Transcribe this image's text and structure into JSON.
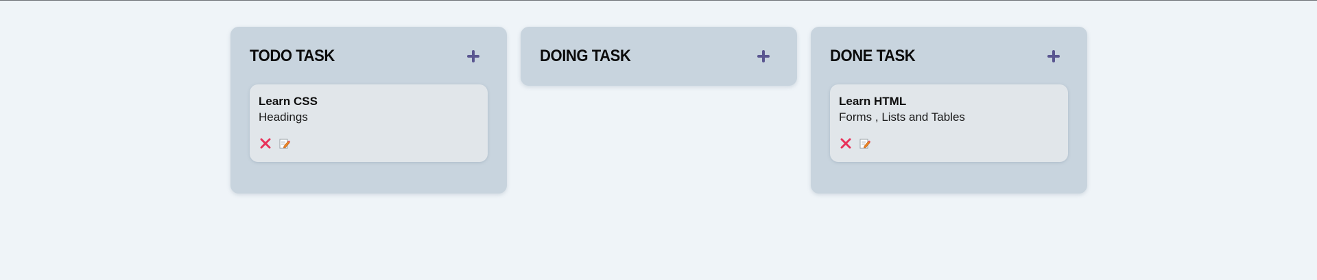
{
  "columns": [
    {
      "title": "TODO TASK",
      "add_icon": "plus-icon",
      "tasks": [
        {
          "title": "Learn CSS",
          "description": "Headings"
        }
      ]
    },
    {
      "title": "DOING TASK",
      "add_icon": "plus-icon",
      "tasks": []
    },
    {
      "title": "DONE TASK",
      "add_icon": "plus-icon",
      "tasks": [
        {
          "title": "Learn HTML",
          "description": "Forms , Lists and Tables"
        }
      ]
    }
  ],
  "icons": {
    "delete": "close-icon",
    "edit": "edit-icon"
  },
  "colors": {
    "page_background": "#eff4f8",
    "column_background": "#c8d4de",
    "card_background": "#e1e6ea",
    "add_icon": "#5a5690",
    "delete_icon": "#e8325a"
  }
}
